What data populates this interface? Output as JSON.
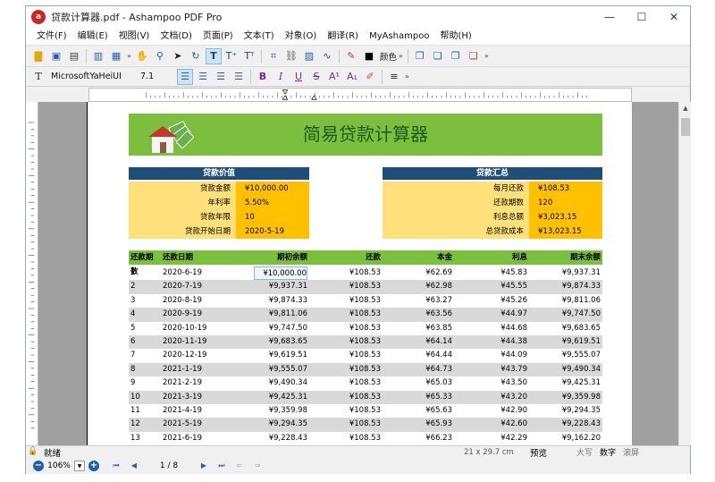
{
  "window": {
    "title": "贷款计算器.pdf - Ashampoo PDF Pro",
    "logo_letter": "a"
  },
  "controls": {
    "minimize": "—",
    "maximize": "☐",
    "close": "✕"
  },
  "menu": [
    "文件(F)",
    "编辑(E)",
    "视图(V)",
    "文档(D)",
    "页面(P)",
    "文本(T)",
    "对象(O)",
    "翻译(R)",
    "MyAshampoo",
    "帮助(H)"
  ],
  "toolbar": {
    "colors_label": "颜色",
    "more": "»"
  },
  "format": {
    "font_name": "MicrosoftYaHeiUI",
    "font_size": "7.1"
  },
  "doc": {
    "title": "简易贷款计算器",
    "loan_value": {
      "header": "贷款价值",
      "rows": [
        {
          "label": "贷款金额",
          "value": "¥10,000.00"
        },
        {
          "label": "年利率",
          "value": "5.50%"
        },
        {
          "label": "贷款年限",
          "value": "10"
        },
        {
          "label": "贷款开始日期",
          "value": "2020-5-19"
        }
      ]
    },
    "loan_summary": {
      "header": "贷款汇总",
      "rows": [
        {
          "label": "每月还款",
          "value": "¥108.53"
        },
        {
          "label": "还款期数",
          "value": "120"
        },
        {
          "label": "利息总额",
          "value": "¥3,023.15"
        },
        {
          "label": "总贷款成本",
          "value": "¥13,023.15"
        }
      ]
    },
    "table": {
      "headers": [
        "还款期数",
        "还款日期",
        "期初余额",
        "还款",
        "本金",
        "利息",
        "期末余额"
      ],
      "rows": [
        [
          "1",
          "2020-6-19",
          "¥10,000.00",
          "¥108.53",
          "¥62.69",
          "¥45.83",
          "¥9,937.31"
        ],
        [
          "2",
          "2020-7-19",
          "¥9,937.31",
          "¥108.53",
          "¥62.98",
          "¥45.55",
          "¥9,874.33"
        ],
        [
          "3",
          "2020-8-19",
          "¥9,874.33",
          "¥108.53",
          "¥63.27",
          "¥45.26",
          "¥9,811.06"
        ],
        [
          "4",
          "2020-9-19",
          "¥9,811.06",
          "¥108.53",
          "¥63.56",
          "¥44.97",
          "¥9,747.50"
        ],
        [
          "5",
          "2020-10-19",
          "¥9,747.50",
          "¥108.53",
          "¥63.85",
          "¥44.68",
          "¥9,683.65"
        ],
        [
          "6",
          "2020-11-19",
          "¥9,683.65",
          "¥108.53",
          "¥64.14",
          "¥44.38",
          "¥9,619.51"
        ],
        [
          "7",
          "2020-12-19",
          "¥9,619.51",
          "¥108.53",
          "¥64.44",
          "¥44.09",
          "¥9,555.07"
        ],
        [
          "8",
          "2021-1-19",
          "¥9,555.07",
          "¥108.53",
          "¥64.73",
          "¥43.79",
          "¥9,490.34"
        ],
        [
          "9",
          "2021-2-19",
          "¥9,490.34",
          "¥108.53",
          "¥65.03",
          "¥43.50",
          "¥9,425.31"
        ],
        [
          "10",
          "2021-3-19",
          "¥9,425.31",
          "¥108.53",
          "¥65.33",
          "¥43.20",
          "¥9,359.98"
        ],
        [
          "11",
          "2021-4-19",
          "¥9,359.98",
          "¥108.53",
          "¥65.63",
          "¥42.90",
          "¥9,294.35"
        ],
        [
          "12",
          "2021-5-19",
          "¥9,294.35",
          "¥108.53",
          "¥65.93",
          "¥42.60",
          "¥9,228.43"
        ],
        [
          "13",
          "2021-6-19",
          "¥9,228.43",
          "¥108.53",
          "¥66.23",
          "¥42.29",
          "¥9,162.20"
        ]
      ]
    }
  },
  "status": {
    "text": "就绪",
    "page_size": "21 x 29.7 cm",
    "preview": "预览",
    "caps": "大写",
    "num": "数字",
    "scroll": "滚屏"
  },
  "nav": {
    "zoom": "106%",
    "page": "1 / 8",
    "zoom_out": "−",
    "zoom_in": "+"
  },
  "colors": {
    "accent_green": "#7cbf3f",
    "header_navy": "#1f4e79",
    "amber": "#ffc000",
    "light_amber": "#ffe07a"
  }
}
